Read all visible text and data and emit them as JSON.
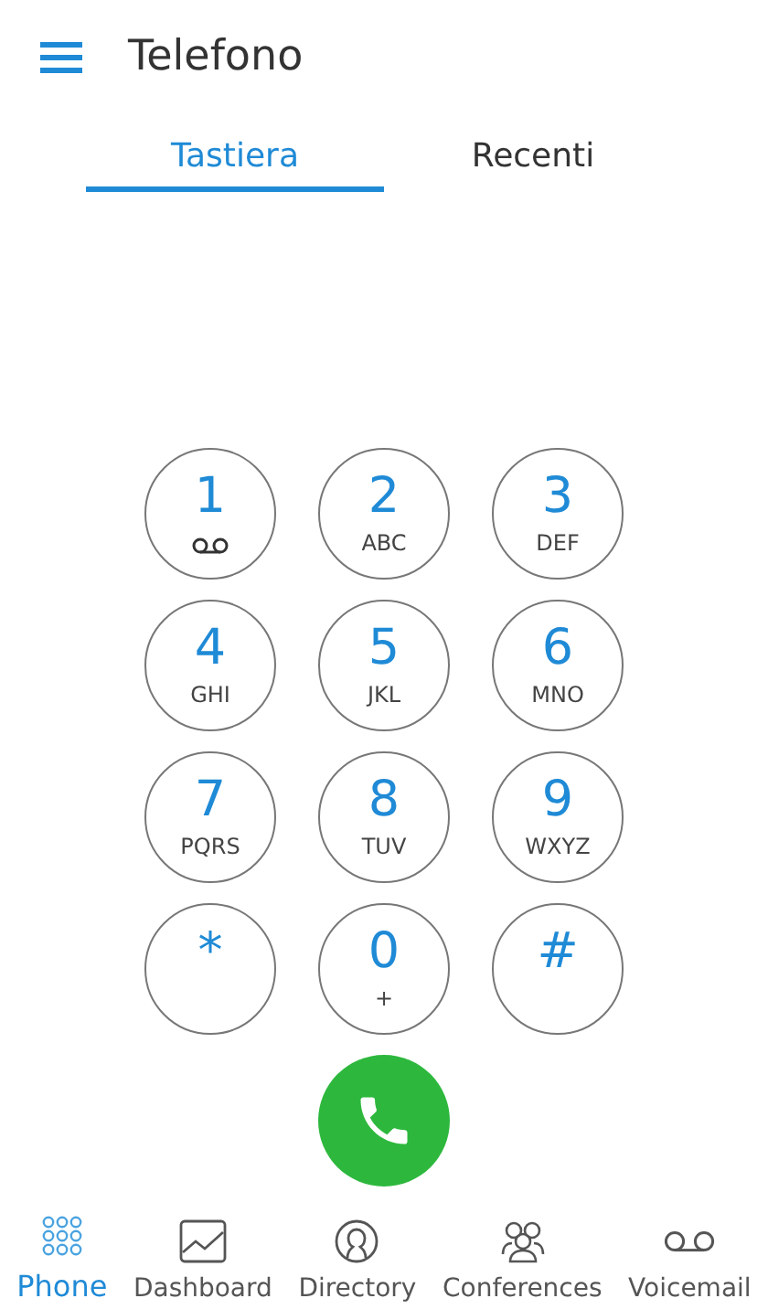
{
  "header": {
    "title": "Telefono"
  },
  "tabs": [
    {
      "label": "Tastiera",
      "selected": true
    },
    {
      "label": "Recenti",
      "selected": false
    }
  ],
  "keypad": [
    {
      "digit": "1",
      "kind": "voicemail"
    },
    {
      "digit": "2",
      "kind": "letters",
      "letters": "ABC"
    },
    {
      "digit": "3",
      "kind": "letters",
      "letters": "DEF"
    },
    {
      "digit": "4",
      "kind": "letters",
      "letters": "GHI"
    },
    {
      "digit": "5",
      "kind": "letters",
      "letters": "JKL"
    },
    {
      "digit": "6",
      "kind": "letters",
      "letters": "MNO"
    },
    {
      "digit": "7",
      "kind": "letters",
      "letters": "PQRS"
    },
    {
      "digit": "8",
      "kind": "letters",
      "letters": "TUV"
    },
    {
      "digit": "9",
      "kind": "letters",
      "letters": "WXYZ"
    },
    {
      "digit": "*",
      "kind": "plain"
    },
    {
      "digit": "0",
      "kind": "letters",
      "letters": "+"
    },
    {
      "digit": "#",
      "kind": "plain"
    }
  ],
  "nav": [
    {
      "label": "Phone",
      "kind": "keypad",
      "selected": true
    },
    {
      "label": "Dashboard",
      "kind": "chart",
      "selected": false
    },
    {
      "label": "Directory",
      "kind": "person",
      "selected": false
    },
    {
      "label": "Conferences",
      "kind": "group",
      "selected": false
    },
    {
      "label": "Voicemail",
      "kind": "voicemail",
      "selected": false
    }
  ]
}
